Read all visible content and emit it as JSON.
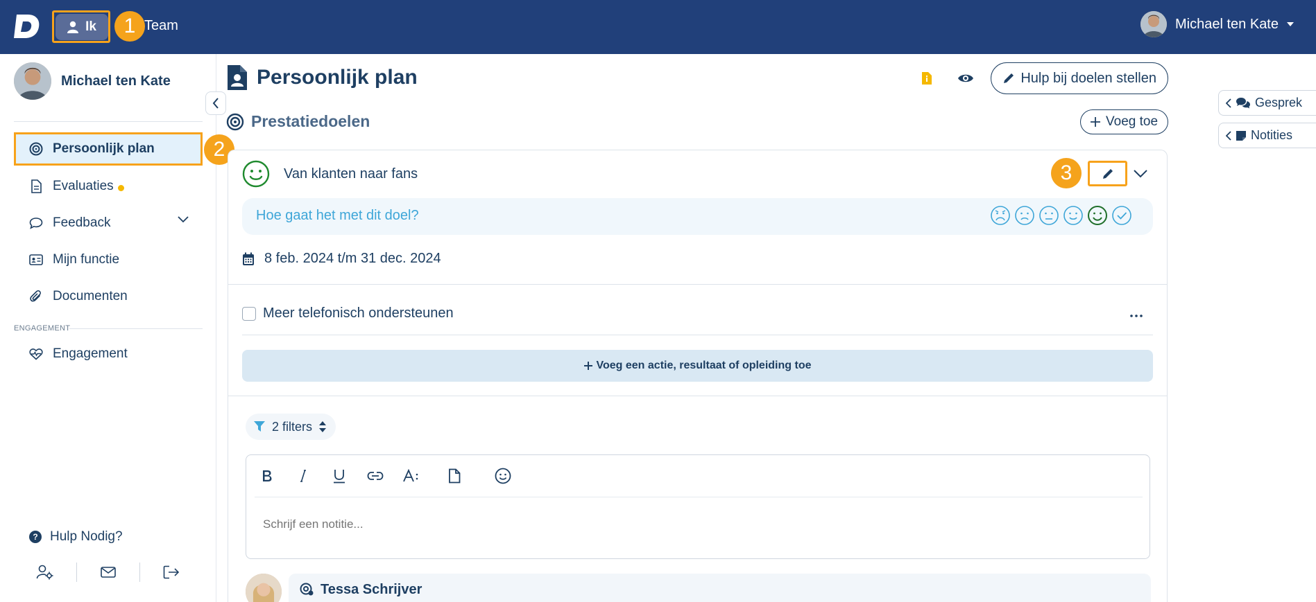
{
  "topbar": {
    "logo_letter": "D",
    "ik_label": "Ik",
    "team_label": "Team",
    "user_name": "Michael ten Kate",
    "callout_1": "1"
  },
  "sidebar": {
    "profile_name": "Michael ten Kate",
    "items": [
      {
        "label": "Persoonlijk plan",
        "icon": "target-icon"
      },
      {
        "label": "Evaluaties",
        "icon": "document-icon"
      },
      {
        "label": "Feedback",
        "icon": "chat-icon"
      },
      {
        "label": "Mijn functie",
        "icon": "id-card-icon"
      },
      {
        "label": "Documenten",
        "icon": "paperclip-icon"
      }
    ],
    "section_label": "ENGAGEMENT",
    "engagement_label": "Engagement",
    "help_label": "Hulp Nodig?",
    "callout_2": "2"
  },
  "main": {
    "page_title": "Persoonlijk plan",
    "help_goals_label": "Hulp bij doelen stellen",
    "section_title": "Prestatiedoelen",
    "add_label": "Voeg toe",
    "goal_title": "Van klanten naar fans",
    "callout_3": "3",
    "mood_question": "Hoe gaat het met dit doel?",
    "date_range": "8 feb. 2024 t/m 31 dec. 2024",
    "task_label": "Meer telefonisch ondersteunen",
    "add_action_label": "Voeg een actie, resultaat of opleiding toe",
    "filter_label": "2 filters",
    "editor_placeholder": "Schrijf een notitie...",
    "comment_author": "Tessa Schrijver"
  },
  "right_tabs": {
    "gesprek": "Gesprek",
    "notities": "Notities"
  },
  "colors": {
    "topbar": "#21407a",
    "highlight": "#f7a21b",
    "text": "#1e3f62",
    "accent": "#3ea6d8",
    "happy": "#1f8a2e"
  }
}
